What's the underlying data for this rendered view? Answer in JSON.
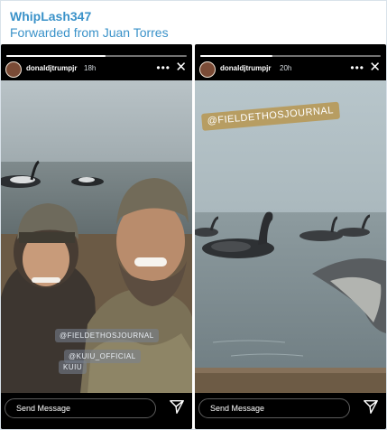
{
  "message": {
    "sender": "WhipLash347",
    "forwarded_label": "Forwarded from Juan Torres"
  },
  "stories": [
    {
      "username": "donaldjtrumpjr",
      "time_ago": "18h",
      "tags": [
        "@FIELDETHOSJOURNAL",
        "@KUIU_OFFICIAL"
      ],
      "jacket_logo": "KUIU",
      "footer_placeholder": "Send Message",
      "progress": 0.55
    },
    {
      "username": "donaldjtrumpjr",
      "time_ago": "20h",
      "tags": [
        "@FIELDETHOSJOURNAL"
      ],
      "footer_placeholder": "Send Message",
      "progress": 0.4
    }
  ],
  "icons": [
    "more-dots-icon",
    "close-icon",
    "send-icon"
  ]
}
